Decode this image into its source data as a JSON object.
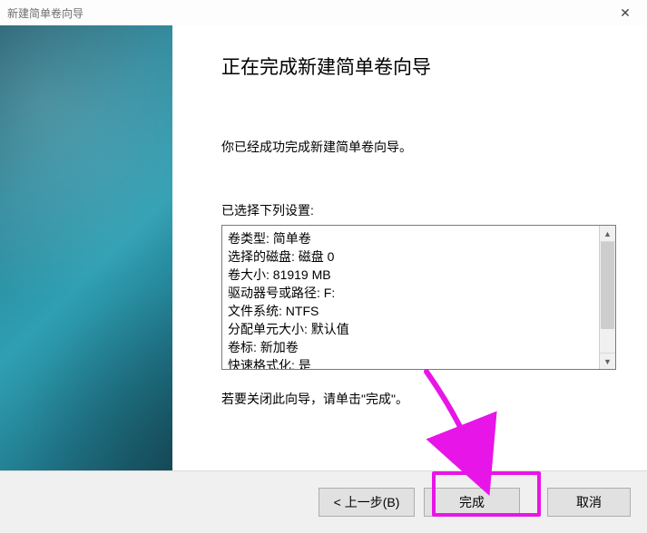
{
  "window": {
    "title": "新建简单卷向导"
  },
  "content": {
    "heading": "正在完成新建简单卷向导",
    "intro": "你已经成功完成新建简单卷向导。",
    "settings_label": "已选择下列设置:",
    "settings_lines": [
      "卷类型: 简单卷",
      "选择的磁盘: 磁盘 0",
      "卷大小: 81919 MB",
      "驱动器号或路径: F:",
      "文件系统: NTFS",
      "分配单元大小: 默认值",
      "卷标: 新加卷",
      "快速格式化: 是"
    ],
    "closing_note": "若要关闭此向导，请单击\"完成\"。"
  },
  "footer": {
    "back": "< 上一步(B)",
    "finish": "完成",
    "cancel": "取消"
  },
  "annotation": {
    "highlight_color": "#e815e8"
  }
}
